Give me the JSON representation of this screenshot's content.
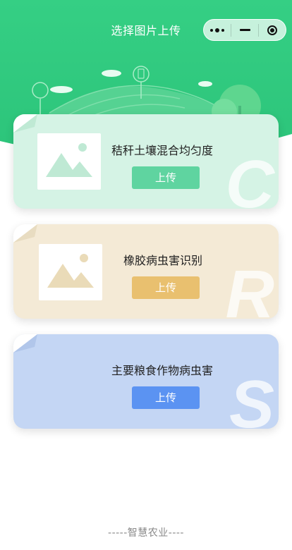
{
  "nav": {
    "title": "选择图片上传",
    "capsule": {
      "more_icon": "more-dots-icon",
      "minimize_icon": "minus-icon",
      "close_icon": "target-icon"
    }
  },
  "cards": [
    {
      "title": "秸秆土壤混合均匀度",
      "button": "上传",
      "letter": "C",
      "has_image": true,
      "bg": "#d5f3e5",
      "accent": "#5fd4a0",
      "icon": "image-placeholder-icon"
    },
    {
      "title": "橡胶病虫害识别",
      "button": "上传",
      "letter": "R",
      "has_image": true,
      "bg": "#f4ead6",
      "accent": "#e9c06f",
      "icon": "image-placeholder-icon"
    },
    {
      "title": "主要粮食作物病虫害",
      "button": "上传",
      "letter": "S",
      "has_image": false,
      "bg": "#c4d6f4",
      "accent": "#5b93f2"
    }
  ],
  "footer": {
    "text": "-----智慧农业----"
  },
  "colors": {
    "banner_top": "#3ccf86",
    "banner_bottom": "#2ec27a"
  }
}
